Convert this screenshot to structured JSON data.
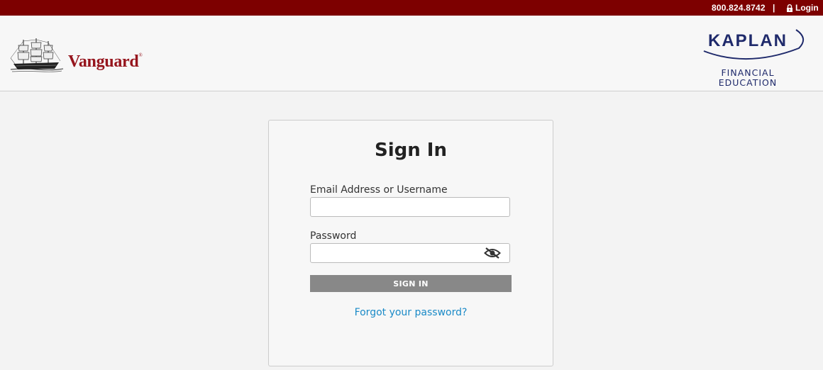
{
  "topbar": {
    "phone": "800.824.8742",
    "separator": "|",
    "login_label": "Login",
    "login_icon": "lock-icon"
  },
  "header": {
    "vanguard_text": "Vanguard",
    "vanguard_mark": "®",
    "kaplan_text": "KAPLAN",
    "kaplan_sub1": "FINANCIAL",
    "kaplan_sub2": "EDUCATION"
  },
  "signin": {
    "title": "Sign In",
    "email_label": "Email Address or Username",
    "email_value": "",
    "password_label": "Password",
    "password_value": "",
    "password_toggle_icon": "eye-slash-icon",
    "button_label": "SIGN IN",
    "forgot_link": "Forgot your password?"
  },
  "colors": {
    "topbar_bg": "#7d0000",
    "vanguard_red": "#96151d",
    "kaplan_blue": "#1f2a6b",
    "button_gray": "#888888",
    "link_blue": "#1a8ac7"
  }
}
